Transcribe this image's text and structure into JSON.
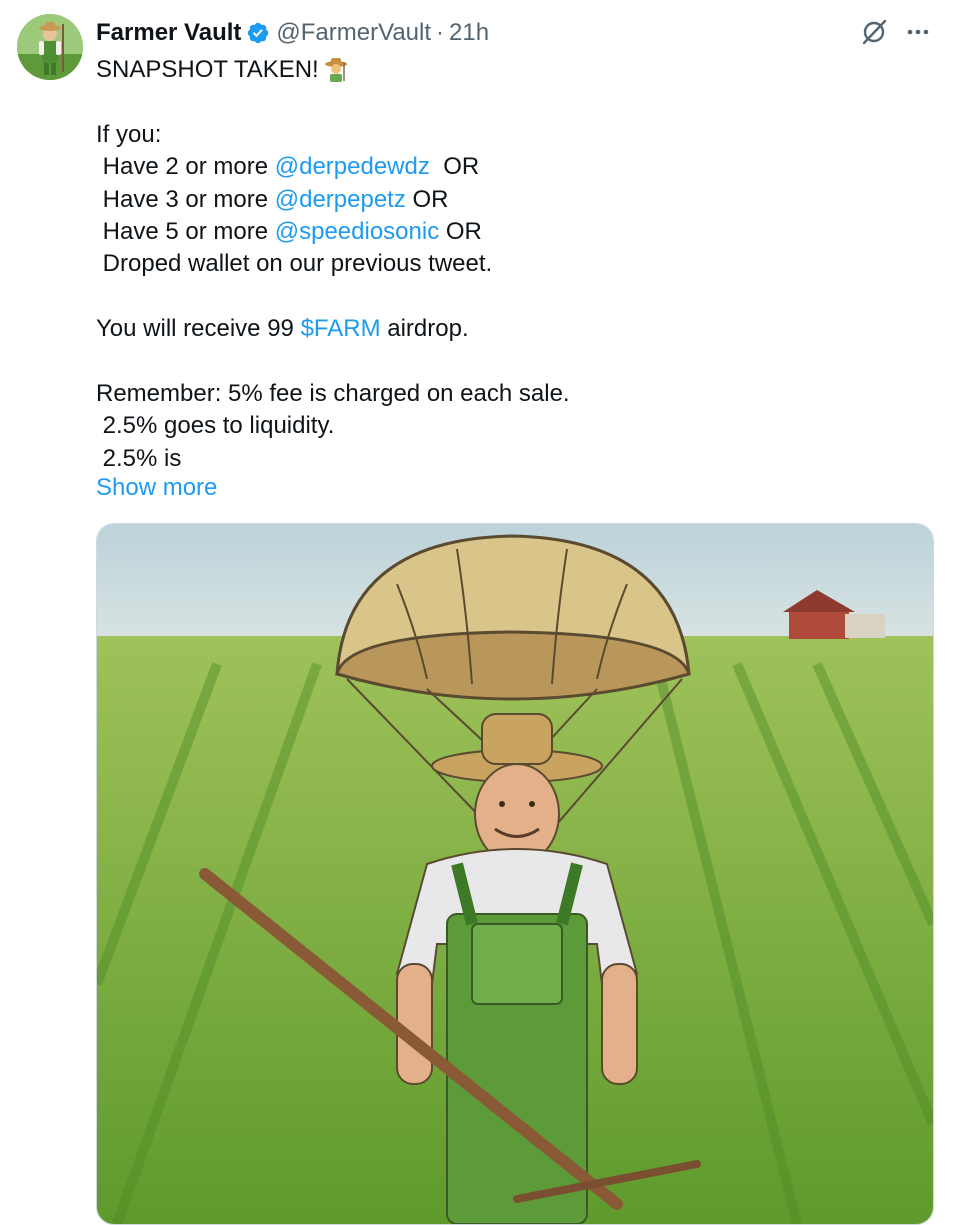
{
  "tweet": {
    "author": {
      "display_name": "Farmer Vault",
      "handle": "@FarmerVault",
      "separator": "·",
      "time": "21h",
      "avatar_icon": "farmer-avatar",
      "verified_icon": "verified-badge-icon"
    },
    "actions": {
      "grok_icon": "grok-icon",
      "more_icon": "more-icon"
    },
    "text": {
      "line1": "SNAPSHOT TAKEN!",
      "line1_emoji": "farmer-emoji",
      "line2": "If you:",
      "line3_pre": " Have 2 or more ",
      "line3_mention": "@derpedewdz",
      "line3_post": "  OR",
      "line4_pre": " Have 3 or more ",
      "line4_mention": "@derpepetz",
      "line4_post": " OR",
      "line5_pre": " Have 5 or more ",
      "line5_mention": "@speediosonic",
      "line5_post": " OR",
      "line6": " Droped wallet on our previous tweet.",
      "line7_pre": "You will receive 99 ",
      "line7_cashtag": "$FARM",
      "line7_post": " airdrop.",
      "line8": "Remember: 5% fee is charged on each sale.",
      "line9": " 2.5% goes to liquidity.",
      "line10": " 2.5% is"
    },
    "show_more": "Show more",
    "media": {
      "alt": "Illustration of a smiling farmer in green overalls and straw hat with a parachute, holding a rake in a green field with a red barn in the distance"
    },
    "colors": {
      "link": "#1d9bf0",
      "secondary_text": "#536471",
      "primary_text": "#0f1419",
      "verified": "#1d9bf0"
    }
  }
}
